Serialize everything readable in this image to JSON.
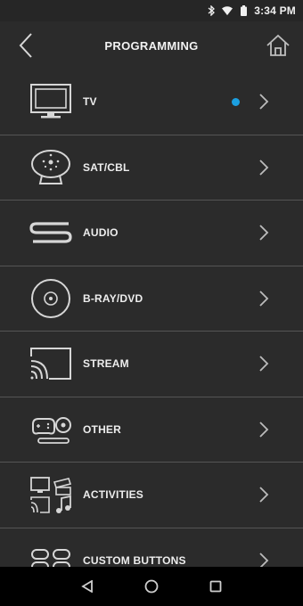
{
  "status_bar": {
    "time": "3:34 PM",
    "icons": [
      "bluetooth-icon",
      "wifi-icon",
      "battery-icon"
    ]
  },
  "header": {
    "title": "PROGRAMMING",
    "back_icon": "back-chevron-icon",
    "home_icon": "home-icon"
  },
  "devices": [
    {
      "label": "TV",
      "icon": "tv-icon",
      "indicator": true
    },
    {
      "label": "SAT/CBL",
      "icon": "satellite-icon",
      "indicator": false
    },
    {
      "label": "AUDIO",
      "icon": "audio-icon",
      "indicator": false
    },
    {
      "label": "B-RAY/DVD",
      "icon": "disc-icon",
      "indicator": false
    },
    {
      "label": "STREAM",
      "icon": "stream-icon",
      "indicator": false
    },
    {
      "label": "OTHER",
      "icon": "gamepad-icon",
      "indicator": false
    },
    {
      "label": "ACTIVITIES",
      "icon": "activities-icon",
      "indicator": false
    },
    {
      "label": "CUSTOM BUTTONS",
      "icon": "custom-buttons-icon",
      "indicator": false
    }
  ],
  "colors": {
    "background": "#2b2b2b",
    "divider": "#555555",
    "accent_dot": "#1b9fe0",
    "text": "#ededed"
  },
  "nav_bar": {
    "icons": [
      "nav-back-icon",
      "nav-home-icon",
      "nav-recents-icon"
    ]
  }
}
